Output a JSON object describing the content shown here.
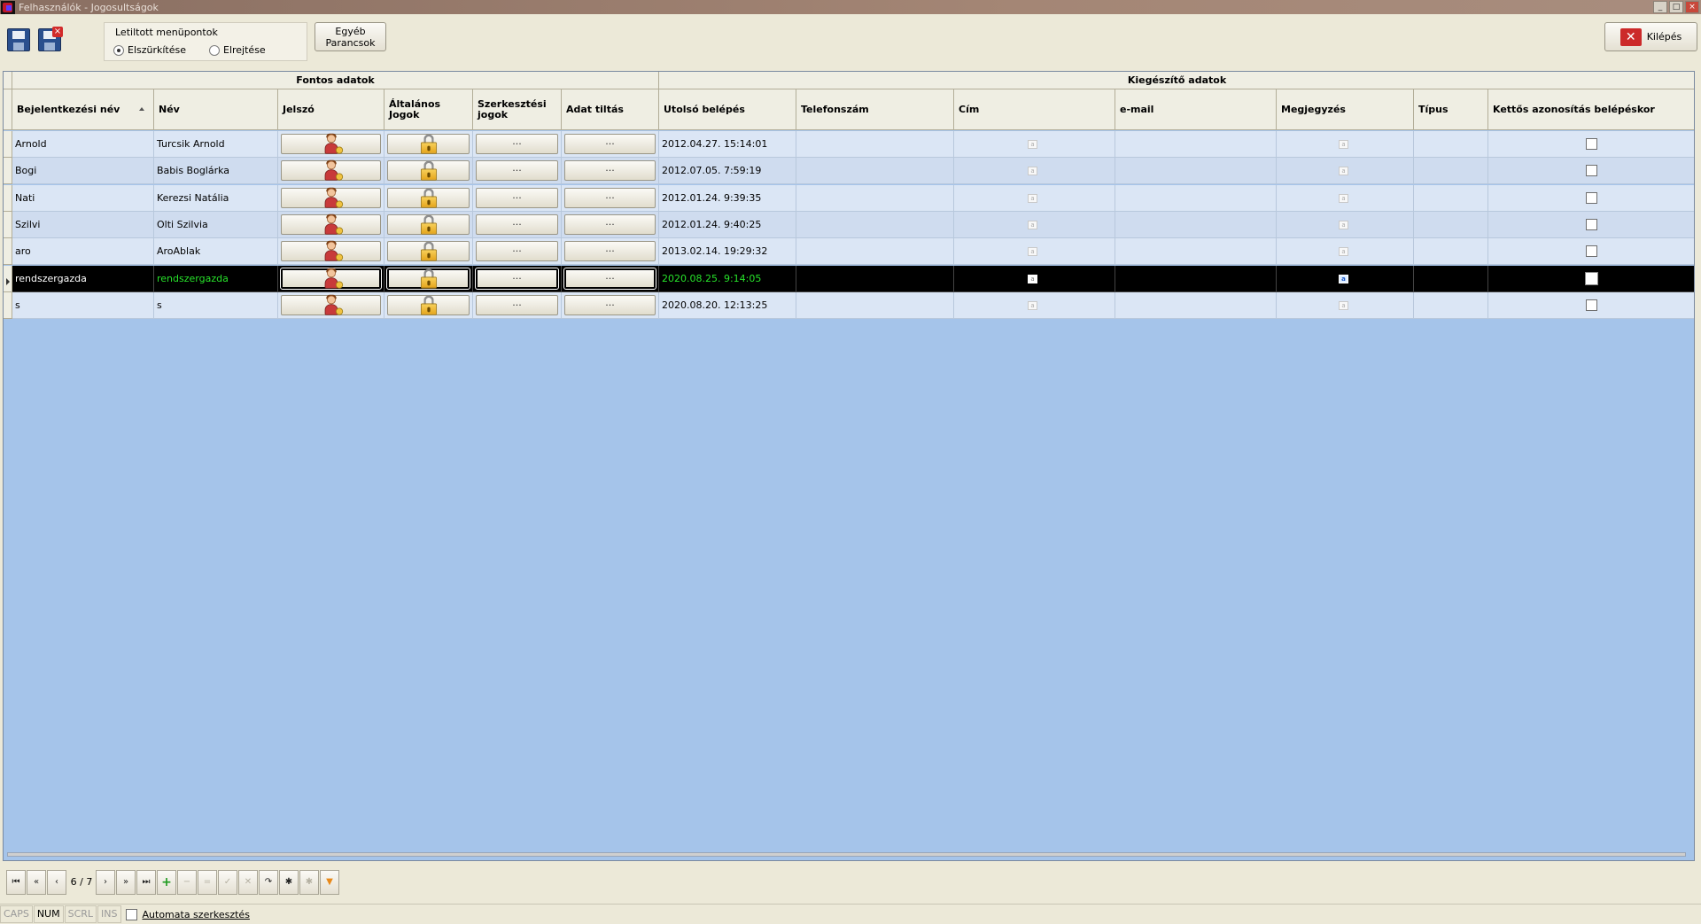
{
  "window": {
    "title": "Felhasználók - Jogosultságok",
    "buttons": [
      "_",
      "□",
      "×"
    ]
  },
  "toolbar": {
    "disabled_menu_group": {
      "legend": "Letiltott menüpontok",
      "options": [
        {
          "label": "Elszürkítése",
          "selected": true
        },
        {
          "label": "Elrejtése",
          "selected": false
        }
      ]
    },
    "other_commands": [
      "Egyéb",
      "Parancsok"
    ],
    "exit_label": "Kilépés"
  },
  "grid": {
    "groups": [
      "Fontos adatok",
      "Kiegészítő adatok"
    ],
    "columns": [
      "Bejelentkezési név",
      "Név",
      "Jelszó",
      "Általános Jogok",
      "Szerkesztési jogok",
      "Adat tiltás",
      "Utolsó belépés",
      "Telefonszám",
      "Cím",
      "e-mail",
      "Megjegyzés",
      "Típus",
      "Kettős azonosítás belépéskor"
    ],
    "ellipsis": "···",
    "memo_glyph": "a",
    "rows": [
      {
        "login": "Arnold",
        "name": "Turcsik Arnold",
        "last_login": "2012.04.27. 15:14:01"
      },
      {
        "login": "Bogi",
        "name": "Babis Boglárka",
        "last_login": "2012.07.05. 7:59:19"
      },
      {
        "login": "Nati",
        "name": "Kerezsi Natália",
        "last_login": "2012.01.24. 9:39:35"
      },
      {
        "login": "Szilvi",
        "name": "Olti Szilvia",
        "last_login": "2012.01.24. 9:40:25"
      },
      {
        "login": "aro",
        "name": "AroAblak",
        "last_login": "2013.02.14. 19:29:32"
      },
      {
        "login": "rendszergazda",
        "name": "rendszergazda",
        "last_login": "2020.08.25. 9:14:05",
        "selected": true
      },
      {
        "login": "s",
        "name": "s",
        "last_login": "2020.08.20. 12:13:25"
      }
    ]
  },
  "navigator": {
    "position": "6 / 7"
  },
  "statusbar": {
    "indicators": [
      "CAPS",
      "NUM",
      "SCRL",
      "INS"
    ],
    "active_indicator": "NUM",
    "auto_edit_label": "Automata szerkesztés"
  },
  "colors": {
    "grid_bg": "#a5c4ea",
    "selected_row": "#000000",
    "selected_text": "#27e22a"
  }
}
